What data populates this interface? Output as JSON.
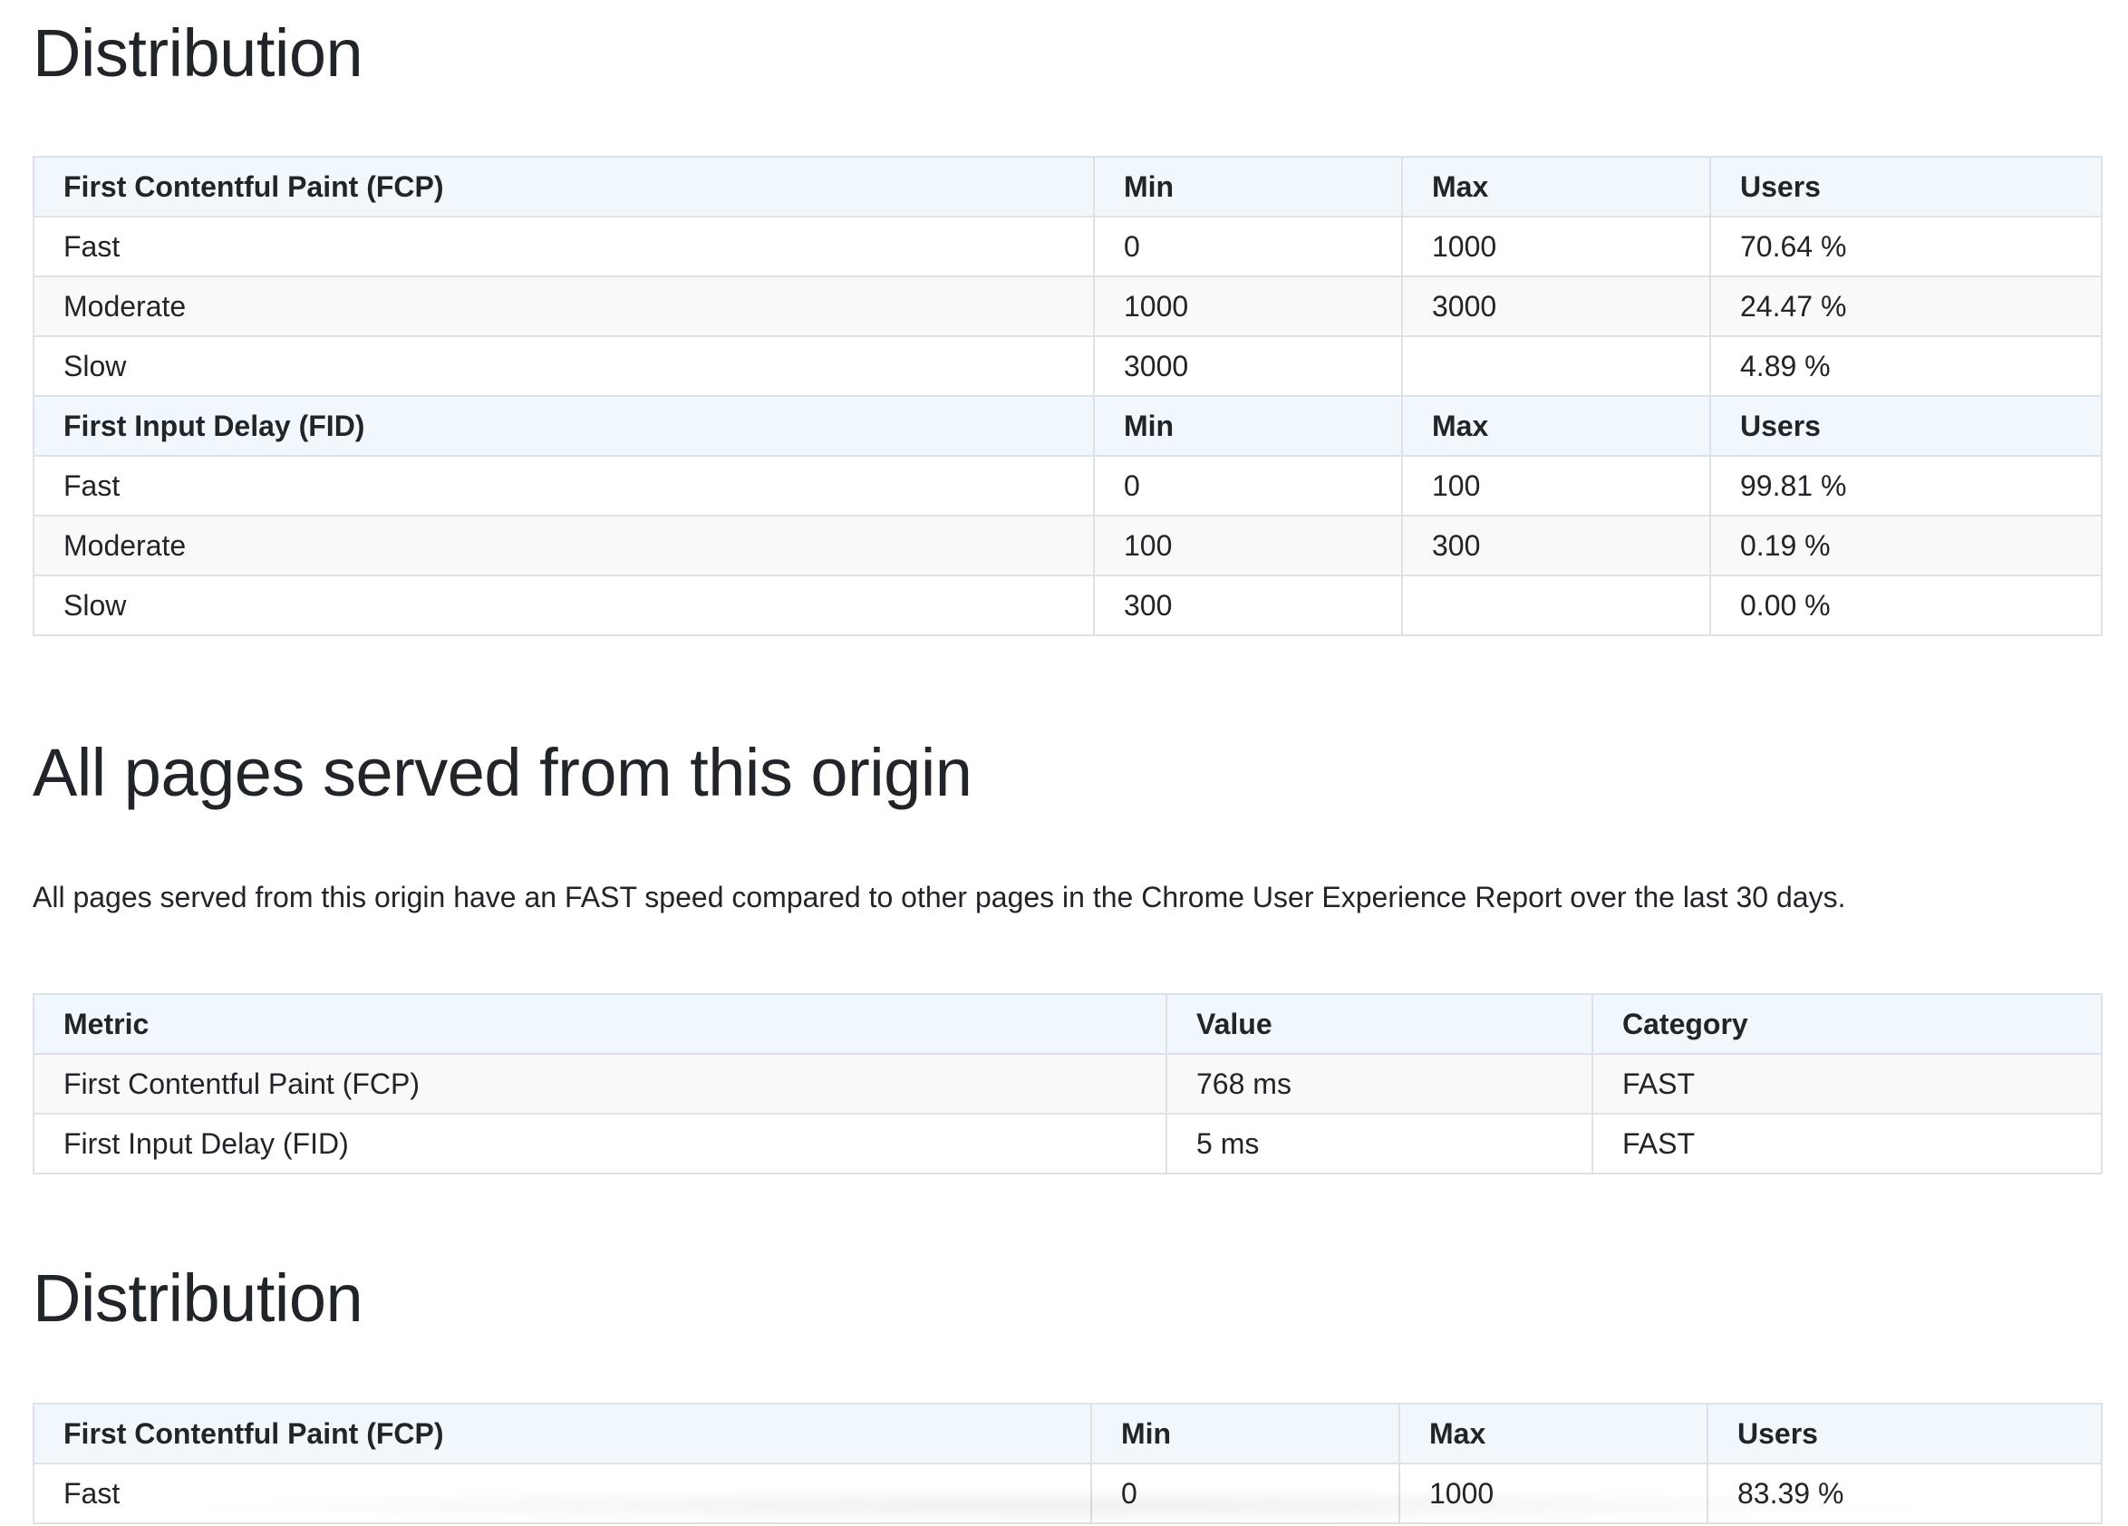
{
  "section1": {
    "heading": "Distribution",
    "rows": [
      {
        "type": "head",
        "label": "First Contentful Paint (FCP)",
        "min": "Min",
        "max": "Max",
        "users": "Users"
      },
      {
        "type": "plain",
        "label": "Fast",
        "min": "0",
        "max": "1000",
        "users": "70.64 %"
      },
      {
        "type": "stripe",
        "label": "Moderate",
        "min": "1000",
        "max": "3000",
        "users": "24.47 %"
      },
      {
        "type": "plain",
        "label": "Slow",
        "min": "3000",
        "max": "",
        "users": "4.89 %"
      },
      {
        "type": "head",
        "label": "First Input Delay (FID)",
        "min": "Min",
        "max": "Max",
        "users": "Users"
      },
      {
        "type": "plain",
        "label": "Fast",
        "min": "0",
        "max": "100",
        "users": "99.81 %"
      },
      {
        "type": "stripe",
        "label": "Moderate",
        "min": "100",
        "max": "300",
        "users": "0.19 %"
      },
      {
        "type": "plain",
        "label": "Slow",
        "min": "300",
        "max": "",
        "users": "0.00 %"
      }
    ]
  },
  "section2": {
    "heading": "All pages served from this origin",
    "description": "All pages served from this origin have an FAST speed compared to other pages in the Chrome User Experience Report over the last 30 days.",
    "header": {
      "metric": "Metric",
      "value": "Value",
      "category": "Category"
    },
    "rows": [
      {
        "metric": "First Contentful Paint (FCP)",
        "value": "768 ms",
        "category": "FAST"
      },
      {
        "metric": "First Input Delay (FID)",
        "value": "5 ms",
        "category": "FAST"
      }
    ]
  },
  "section3": {
    "heading": "Distribution",
    "rows": [
      {
        "type": "head",
        "label": "First Contentful Paint (FCP)",
        "min": "Min",
        "max": "Max",
        "users": "Users"
      },
      {
        "type": "plain",
        "label": "Fast",
        "min": "0",
        "max": "1000",
        "users": "83.39 %"
      }
    ]
  },
  "colors": {
    "header_bg": "#f0f8fd",
    "stripe_bg": "#f9f9f9",
    "border": "#dee2e6",
    "text": "#212529"
  }
}
